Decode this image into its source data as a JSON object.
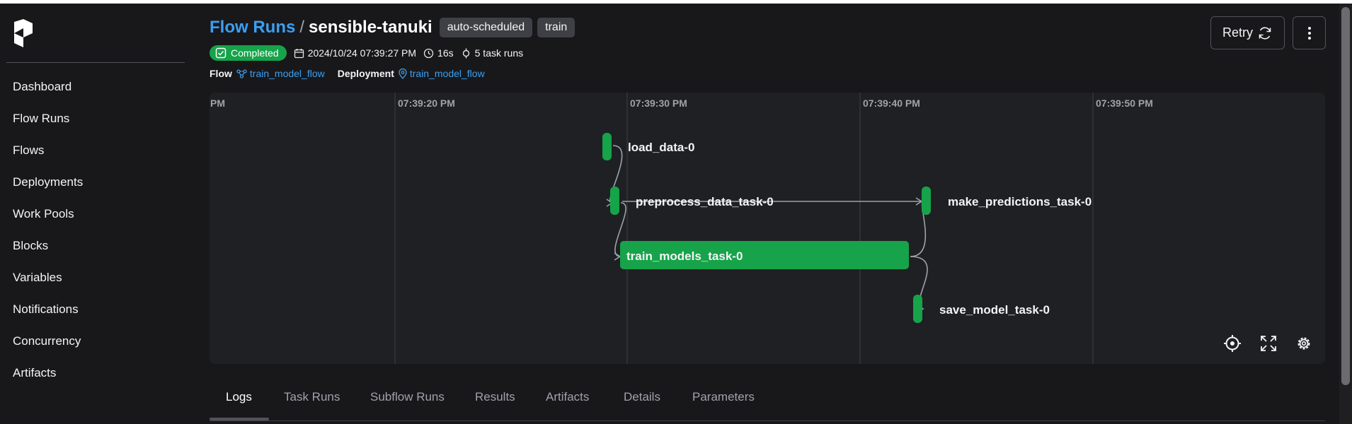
{
  "sidebar": {
    "items": [
      {
        "label": "Dashboard"
      },
      {
        "label": "Flow Runs"
      },
      {
        "label": "Flows"
      },
      {
        "label": "Deployments"
      },
      {
        "label": "Work Pools"
      },
      {
        "label": "Blocks"
      },
      {
        "label": "Variables"
      },
      {
        "label": "Notifications"
      },
      {
        "label": "Concurrency"
      },
      {
        "label": "Artifacts"
      }
    ]
  },
  "header": {
    "breadcrumb_root": "Flow Runs",
    "breadcrumb_separator": "/",
    "run_name": "sensible-tanuki",
    "tags": [
      "auto-scheduled",
      "train"
    ],
    "status": "Completed",
    "start_time": "2024/10/24 07:39:27 PM",
    "duration": "16s",
    "task_runs": "5 task runs",
    "flow_label": "Flow",
    "flow_name": "train_model_flow",
    "deployment_label": "Deployment",
    "deployment_name": "train_model_flow",
    "retry_label": "Retry"
  },
  "timeline": {
    "ticks": [
      "PM",
      "07:39:20 PM",
      "07:39:30 PM",
      "07:39:40 PM",
      "07:39:50 PM"
    ],
    "tasks": [
      {
        "name": "load_data-0",
        "state": "Completed"
      },
      {
        "name": "preprocess_data_task-0",
        "state": "Completed"
      },
      {
        "name": "train_models_task-0",
        "state": "Completed"
      },
      {
        "name": "make_predictions_task-0",
        "state": "Completed"
      },
      {
        "name": "save_model_task-0",
        "state": "Completed"
      }
    ],
    "bar_color": "#16a34a"
  },
  "tabs": [
    {
      "label": "Logs",
      "active": true
    },
    {
      "label": "Task Runs"
    },
    {
      "label": "Subflow Runs"
    },
    {
      "label": "Results"
    },
    {
      "label": "Artifacts"
    },
    {
      "label": "Details"
    },
    {
      "label": "Parameters"
    }
  ],
  "colors": {
    "accent": "#3b9ff0",
    "success": "#16a34a",
    "background": "#18181b"
  }
}
